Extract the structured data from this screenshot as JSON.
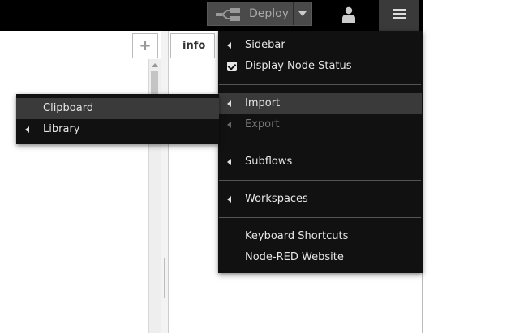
{
  "header": {
    "deploy_label": "Deploy"
  },
  "workspace": {
    "add_tab_label": "+"
  },
  "sidebar": {
    "tabs": [
      {
        "label": "info"
      }
    ]
  },
  "main_menu": {
    "items": [
      {
        "label": "Sidebar",
        "submenu": true
      },
      {
        "label": "Display Node Status",
        "checked": true
      },
      {
        "label": "Import",
        "submenu": true,
        "highlighted": true
      },
      {
        "label": "Export",
        "submenu": true,
        "disabled": true
      },
      {
        "label": "Subflows",
        "submenu": true
      },
      {
        "label": "Workspaces",
        "submenu": true
      },
      {
        "label": "Keyboard Shortcuts"
      },
      {
        "label": "Node-RED Website"
      }
    ]
  },
  "import_submenu": {
    "items": [
      {
        "label": "Clipboard",
        "highlighted": true
      },
      {
        "label": "Library",
        "submenu": true
      }
    ]
  },
  "colors": {
    "header_bg": "#000000",
    "menu_bg": "#111111",
    "menu_highlight": "#3a3a3a",
    "deploy_bg": "#4a4a4a"
  },
  "icons": {
    "deploy": "deploy-icon",
    "user": "user-icon",
    "menu": "hamburger-menu-icon",
    "submenu": "caret-left-icon",
    "checkbox": "checkbox-checked-icon"
  }
}
